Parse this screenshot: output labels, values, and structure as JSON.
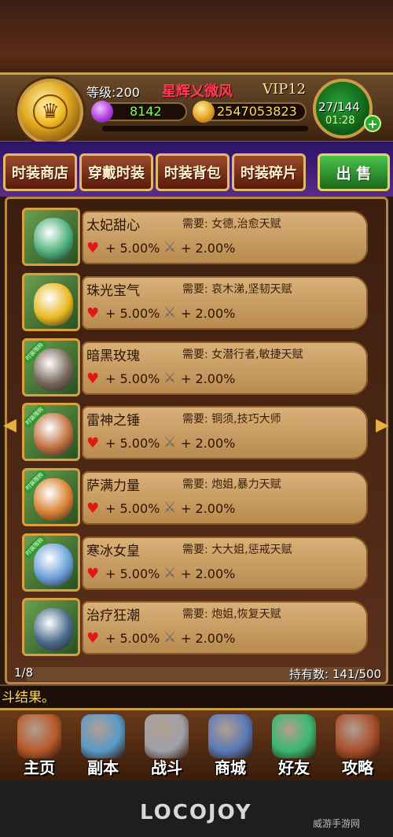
{
  "player": {
    "level": "等级:200",
    "name": "星辉乂微风",
    "vip": "VIP12",
    "gems": "8142",
    "gold": "2547053823",
    "energy": "27/144",
    "timer": "01:28"
  },
  "tabs": [
    "时装商店",
    "穿戴时装",
    "时装背包",
    "时装碎片"
  ],
  "sell_label": "出 售",
  "items": [
    {
      "name": "太妃甜心",
      "need": "需要: 女德,治愈天赋",
      "hp": "+ 5.00%",
      "atk": "+ 2.00%",
      "limited": false,
      "color": "#4caf7a"
    },
    {
      "name": "珠光宝气",
      "need": "需要: 哀木涕,坚韧天赋",
      "hp": "+ 5.00%",
      "atk": "+ 2.00%",
      "limited": false,
      "color": "#e8b820"
    },
    {
      "name": "暗黑玫瑰",
      "need": "需要: 女潜行者,敏捷天赋",
      "hp": "+ 5.00%",
      "atk": "+ 2.00%",
      "limited": true,
      "color": "#7a6a5a"
    },
    {
      "name": "雷神之锤",
      "need": "需要: 铜须,技巧大师",
      "hp": "+ 5.00%",
      "atk": "+ 2.00%",
      "limited": true,
      "color": "#c07040"
    },
    {
      "name": "萨满力量",
      "need": "需要: 炮姐,暴力天赋",
      "hp": "+ 5.00%",
      "atk": "+ 2.00%",
      "limited": true,
      "color": "#d88030"
    },
    {
      "name": "寒冰女皇",
      "need": "需要: 大大姐,惩戒天赋",
      "hp": "+ 5.00%",
      "atk": "+ 2.00%",
      "limited": true,
      "color": "#6aa0d8"
    },
    {
      "name": "治疗狂潮",
      "need": "需要: 炮姐,恢复天赋",
      "hp": "+ 5.00%",
      "atk": "+ 2.00%",
      "limited": false,
      "color": "#4a6a8a"
    }
  ],
  "limited_tag": "时装限购",
  "page": "1/8",
  "owned": "持有数: 141/500",
  "log": "斗结果。",
  "nav": [
    {
      "label": "主页",
      "icon": "home-icon",
      "color": "#b85a2a"
    },
    {
      "label": "副本",
      "icon": "dungeon-icon",
      "color": "#5a9ac8"
    },
    {
      "label": "战斗",
      "icon": "battle-icon",
      "color": "#a0a0a8"
    },
    {
      "label": "商城",
      "icon": "shop-icon",
      "color": "#5a7ab8"
    },
    {
      "label": "好友",
      "icon": "friends-icon",
      "color": "#3ab870"
    },
    {
      "label": "攻略",
      "icon": "guide-icon",
      "color": "#a8502a"
    }
  ],
  "logo": "LOCOJOY",
  "watermark": "威游手游网"
}
